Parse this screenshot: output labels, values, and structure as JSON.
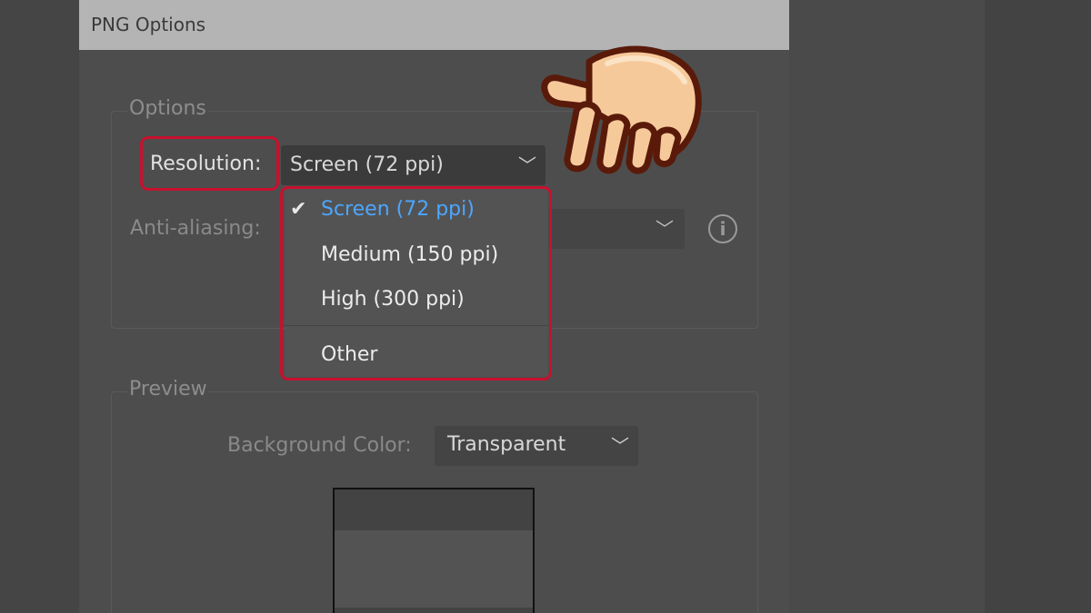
{
  "dialog": {
    "title": "PNG Options"
  },
  "options": {
    "group_label": "Options",
    "resolution": {
      "label": "Resolution:",
      "selected": "Screen (72 ppi)",
      "menu_items": [
        "Screen (72 ppi)",
        "Medium (150 ppi)",
        "High (300 ppi)",
        "Other"
      ],
      "checked_index": 0
    },
    "anti_aliasing": {
      "label": "Anti-aliasing:"
    }
  },
  "preview": {
    "group_label": "Preview",
    "background_color": {
      "label": "Background Color:",
      "selected": "Transparent"
    }
  },
  "colors": {
    "highlight": "#c8102e",
    "selected_item": "#4da6ff",
    "titlebar": "#b4b4b4",
    "dialog_bg": "#4d4d4d"
  },
  "icons": {
    "check": "check-icon",
    "chevron": "chevron-down-icon",
    "info": "info-icon",
    "hand": "pointing-hand-icon"
  }
}
